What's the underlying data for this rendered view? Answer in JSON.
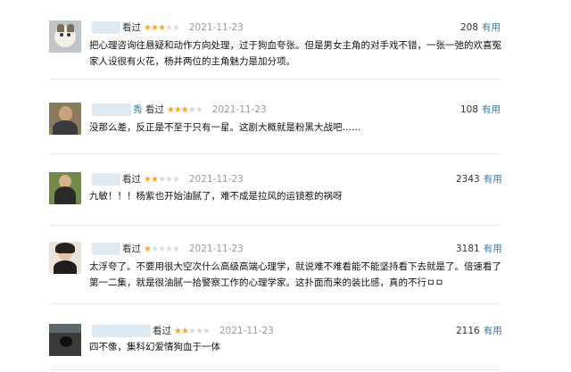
{
  "reviews": [
    {
      "name_tail": "",
      "status": "看过",
      "rating": 3,
      "date": "2021-11-23",
      "votes": "208",
      "useful_label": "有用",
      "avatar": "cat-avatar",
      "text": "把心理咨询往悬疑和动作方向处理，过于狗血夸张。但是男女主角的对手戏不错，一张一弛的欢喜冤家人设很有火花，杨井两位的主角魅力是加分项。"
    },
    {
      "name_tail": "秀",
      "status": "看过",
      "rating": 3,
      "date": "2021-11-23",
      "votes": "108",
      "useful_label": "有用",
      "avatar": "person-avatar",
      "text": "没那么差，反正是不至于只有一星。这剧大概就是粉黑大战吧……"
    },
    {
      "name_tail": "",
      "status": "看过",
      "rating": 2,
      "date": "2021-11-23",
      "votes": "2343",
      "useful_label": "有用",
      "avatar": "child-avatar",
      "text": "九敏！！！杨紫也开始油腻了，难不成是拉风的运镜惹的祸呀"
    },
    {
      "name_tail": "",
      "status": "看过",
      "rating": 1,
      "date": "2021-11-23",
      "votes": "3181",
      "useful_label": "有用",
      "avatar": "woman-avatar",
      "text": "太浮夸了。不要用很大空次什么高级高端心理学，就说难不难看能不能坚持看下去就是了。倍速看了第一二集，就是很油腻一拾警察工作的心理学家。这扑面而来的装比感，真的不行ㅁㅁ"
    },
    {
      "name_tail": "",
      "status": "看过",
      "rating": 2,
      "date": "2021-11-23",
      "votes": "2116",
      "useful_label": "有用",
      "avatar": "dark-avatar",
      "text": "四不像，集科幻爱情狗血于一体"
    }
  ],
  "colors": {
    "star_on": "#f5a623",
    "star_off": "#d9d9d9",
    "useful_link": "#3377aa",
    "date": "#999999",
    "name_blur": "#dfe9f1"
  }
}
